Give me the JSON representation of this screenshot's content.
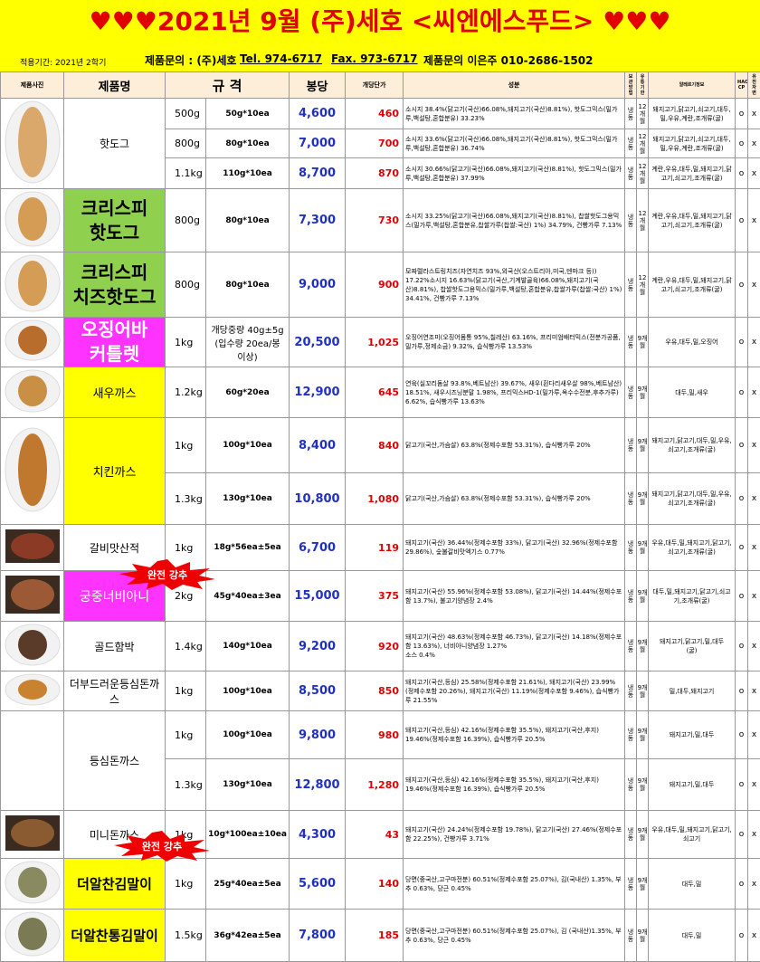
{
  "header": {
    "title": "♥♥♥2021년 9월  (주)세호  <씨엔에스푸드> ♥♥♥",
    "period": "적용기간: 2021년 2학기",
    "contact1": "제품문의 : (주)세호",
    "tel": "Tel. 974-6717",
    "fax": "Fax. 973-6717",
    "contact2": "제품문의 이은주 010-2686-1502"
  },
  "columns": {
    "photo": "제품사진",
    "name": "제품명",
    "spec": "규  격",
    "box": "봉당",
    "unit": "개당단가",
    "ing": "성분",
    "storage": "보관 방법",
    "shelf": "유통 기한",
    "allergy": "알레르기정보",
    "haccp": "HACC CP",
    "gmo": "유전 자변"
  },
  "rows": [
    {
      "name": "핫도그",
      "weight": "500g",
      "spec": "50g*10ea",
      "box": "4,600",
      "unit": "460",
      "ing": "소시지 38.4%(닭고기(국산)66.08%,돼지고기(국산)8.81%), 핫도그믹스(밀가루,백설탕,혼합분유) 33.23%",
      "storage": "냉동",
      "shelf": "12개월",
      "allergy": "돼지고기,닭고기,쇠고기,대두,밀,우유,계란,조개류(굴)",
      "haccp": "o",
      "gmo": "x"
    },
    {
      "weight": "800g",
      "spec": "80g*10ea",
      "box": "7,000",
      "unit": "700",
      "ing": "소시지 33.6%(닭고기(국산)66.08%,돼지고기(국산)8.81%), 핫도그믹스(밀가루,백설탕,혼합분유) 36.74%",
      "storage": "냉동",
      "shelf": "12개월",
      "allergy": "돼지고기,닭고기,쇠고기,대두,밀,우유,계란,조개류(굴)",
      "haccp": "o",
      "gmo": "x"
    },
    {
      "weight": "1.1kg",
      "spec": "110g*10ea",
      "box": "8,700",
      "unit": "870",
      "ing": "소시지 30.66%(닭고기(국산)66.08%,돼지고기(국산)8.81%), 핫도그믹스(밀가루,백설탕,혼합분유) 37.99%",
      "storage": "냉동",
      "shelf": "12개월",
      "allergy": "계란,우유,대두,밀,돼지고기,닭고기,쇠고기,조개류(굴)",
      "haccp": "o",
      "gmo": "x"
    },
    {
      "name": "크리스피\n핫도그",
      "weight": "800g",
      "spec": "80g*10ea",
      "box": "7,300",
      "unit": "730",
      "ing": "소시지 33.25%(닭고기(국산)66.08%,돼지고기(국산)8.81%), 찹쌀핫도그용믹스(밀가루,백설탕,혼합분유,찹쌀가루(찹쌀:국산) 1%) 34.79%, 건빵가루 7.13%",
      "storage": "냉동",
      "shelf": "12개월",
      "allergy": "계란,우유,대두,밀,돼지고기,닭고기,쇠고기,조개류(굴)",
      "haccp": "o",
      "gmo": "x"
    },
    {
      "name": "크리스피\n치즈핫도그",
      "weight": "800g",
      "spec": "80g*10ea",
      "box": "9,000",
      "unit": "900",
      "ing": "모짜렐라스트링치즈(자연치즈 93%,외국산(오스트리아,미국,덴마크 등)) 17.22%소시지 16.63%(닭고기(국산,기계발골육)66.08%,돼지고기(국산)8.81%), 찹쌀핫도그용믹스(밀가루,백설탕,혼합분유,찹쌀가루(찹쌀:국산) 1%) 34.41%, 건빵가루 7.13%",
      "storage": "냉동",
      "shelf": "12개월",
      "allergy": "계란,우유,대두,밀,돼지고기,닭고기,쇠고기,조개류(굴)",
      "haccp": "o",
      "gmo": "x"
    },
    {
      "name": "오징어바\n커틀렛",
      "weight": "1kg",
      "spec": "개당중량 40g±5g\n(입수량 20ea/봉\n이상)",
      "box": "20,500",
      "unit": "1,025",
      "ing": "오징어연조미(오징어몸통 95%,칠레산) 63.16%, 프리미엄배터믹스(전분가공품,밀가루,정제소금) 9.32%, 습식빵가루 13.53%",
      "storage": "냉동",
      "shelf": "9개월",
      "allergy": "우유,대두,밀,오징어",
      "haccp": "o",
      "gmo": "x"
    },
    {
      "name": "새우까스",
      "weight": "1.2kg",
      "spec": "60g*20ea",
      "box": "12,900",
      "unit": "645",
      "ing": "연육(실꼬리돔살 93.8%,베트남산) 39.67%, 새우(흰다리새우살 98%,베트남산) 18.51%, 새우시즈닝분말 1.98%, 프리믹스HD-1(밀가루,옥수수전분,후추가루) 6.62%, 습식빵가루 13.63%",
      "storage": "냉동",
      "shelf": "9개월",
      "allergy": "대두,밀,새우",
      "haccp": "o",
      "gmo": "x"
    },
    {
      "name": "치킨까스",
      "weight": "1kg",
      "spec": "100g*10ea",
      "box": "8,400",
      "unit": "840",
      "ing": "닭고기(국산,가슴살) 63.8%(정제수포함 53.31%), 습식빵가루 20%",
      "storage": "냉동",
      "shelf": "9개월",
      "allergy": "돼지고기,닭고기,대두,밀,우유,쇠고기,조개류(굴)",
      "haccp": "o",
      "gmo": "x"
    },
    {
      "weight": "1.3kg",
      "spec": "130g*10ea",
      "box": "10,800",
      "unit": "1,080",
      "ing": "닭고기(국산,가슴살) 63.8%(정제수포함 53.31%), 습식빵가루 20%",
      "storage": "냉동",
      "shelf": "9개월",
      "allergy": "돼지고기,닭고기,대두,밀,우유,쇠고기,조개류(굴)",
      "haccp": "o",
      "gmo": "x"
    },
    {
      "name": "갈비맛산적",
      "weight": "1kg",
      "spec": "18g*56ea±5ea",
      "box": "6,700",
      "unit": "119",
      "ing": "돼지고기(국산) 36.44%(정제수포함 33%), 닭고기(국산) 32.96%(정제수포함 29.86%), 숯불갈비맛엑기스 0.77%",
      "storage": "냉동",
      "shelf": "9개월",
      "allergy": "우유,대두,밀,돼지고기,닭고기,쇠고기,조개류(굴)",
      "haccp": "o",
      "gmo": "x"
    },
    {
      "name": "궁중너비아니",
      "weight": "2kg",
      "spec": "45g*40ea±3ea",
      "box": "15,000",
      "unit": "375",
      "ing": "돼지고기(국산) 55.96%(정제수포함 53.08%), 닭고기(국산) 14.44%(정제수포함 13.7%), 불고기양념장 2.4%",
      "storage": "냉동",
      "shelf": "9개월",
      "allergy": "대두,밀,돼지고기,닭고기,쇠고기,조개류(굴)",
      "haccp": "o",
      "gmo": "x"
    },
    {
      "name": "골드함박",
      "weight": "1.4kg",
      "spec": "140g*10ea",
      "box": "9,200",
      "unit": "920",
      "ing": "돼지고기(국산) 48.63%(정제수포함 46.73%), 닭고기(국산) 14.18%(정제수포함 13.63%), 너비아니양념장 1.27%\n소스 0.4%",
      "storage": "냉동",
      "shelf": "9개월",
      "allergy": "돼지고기,닭고기,밀,대두\n(굴)",
      "haccp": "o",
      "gmo": "x"
    },
    {
      "name": "더부드러운등심돈까스",
      "weight": "1kg",
      "spec": "100g*10ea",
      "box": "8,500",
      "unit": "850",
      "ing": "돼지고기(국산,등심) 25.58%(정제수포함 21.61%), 돼지고기(국산) 23.99%(정제수포함 20.26%), 돼지고기(국산) 11.19%(정제수포함 9.46%), 습식빵가루 21.55%",
      "storage": "냉동",
      "shelf": "9개월",
      "allergy": "밀,대두,돼지고기",
      "haccp": "o",
      "gmo": "x"
    },
    {
      "name": "등심돈까스",
      "weight": "1kg",
      "spec": "100g*10ea",
      "box": "9,800",
      "unit": "980",
      "ing": "돼지고기(국산,등심) 42.16%(정제수포함 35.5%), 돼지고기(국산,후지) 19.46%(정제수포함 16.39%), 습식빵가루 20.5%",
      "storage": "냉동",
      "shelf": "9개월",
      "allergy": "돼지고기,밀,대두",
      "haccp": "o",
      "gmo": "x"
    },
    {
      "weight": "1.3kg",
      "spec": "130g*10ea",
      "box": "12,800",
      "unit": "1,280",
      "ing": "돼지고기(국산,등심) 42.16%(정제수포함 35.5%), 돼지고기(국산,후지) 19.46%(정제수포함 16.39%), 습식빵가루 20.5%",
      "storage": "냉동",
      "shelf": "9개월",
      "allergy": "돼지고기,밀,대두",
      "haccp": "o",
      "gmo": "x"
    },
    {
      "name": "미니돈까스",
      "weight": "1kg",
      "spec": "10g*100ea±10ea",
      "box": "4,300",
      "unit": "43",
      "ing": "돼지고기(국산) 24.24%(정제수포함 19.78%), 닭고기(국산) 27.46%(정제수포함 22.25%), 건빵가루 3.71%",
      "storage": "냉동",
      "shelf": "9개월",
      "allergy": "우유,대두,밀,돼지고기,닭고기,쇠고기",
      "haccp": "o",
      "gmo": "x"
    },
    {
      "name": "더알찬김말이",
      "weight": "1kg",
      "spec": "25g*40ea±5ea",
      "box": "5,600",
      "unit": "140",
      "ing": "당면(중국산,고구마전분) 60.51%(정제수포함 25.07%), 김(국내산) 1.35%, 부추 0.63%, 당근 0.45%",
      "storage": "냉동",
      "shelf": "9개월",
      "allergy": "대두,밀",
      "haccp": "o",
      "gmo": "x"
    },
    {
      "name": "더알찬통김말이",
      "weight": "1.5kg",
      "spec": "36g*42ea±5ea",
      "box": "7,800",
      "unit": "185",
      "ing": "당면(중국산,고구마전분) 60.51%(정제수포함 25.07%), 김 (국내산)1.35%, 부추 0.63%, 당근 0.45%",
      "storage": "냉동",
      "shelf": "9개월",
      "allergy": "대두,밀",
      "haccp": "o",
      "gmo": "x"
    }
  ],
  "badges": {
    "b1": "완전 강추",
    "b2": "완전 강추"
  },
  "colors": {
    "banner": "#ffff00",
    "title": "#e00000",
    "box": "#2030c0",
    "unit": "#e00000",
    "green": "#8fd14f",
    "pink": "#ff33ff",
    "badge": "#ee0000"
  }
}
